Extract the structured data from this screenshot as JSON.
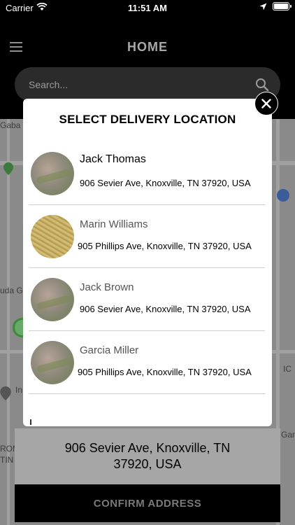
{
  "status_bar": {
    "carrier": "Carrier",
    "time": "11:51 AM"
  },
  "header": {
    "title": "HOME"
  },
  "search": {
    "placeholder": "Search..."
  },
  "map": {
    "labels": [
      "Gaba T",
      "uda Ga",
      "In",
      "Gard",
      "IC",
      "ROM",
      "TIN"
    ]
  },
  "modal": {
    "title": "SELECT DELIVERY LOCATION",
    "locations": [
      {
        "name": "Jack Thomas",
        "address": "906 Sevier Ave, Knoxville, TN 37920, USA"
      },
      {
        "name": "Marin Williams",
        "address": "905 Phillips Ave, Knoxville, TN 37920, USA"
      },
      {
        "name": "Jack Brown",
        "address": "906 Sevier Ave, Knoxville, TN 37920, USA"
      },
      {
        "name": "Garcia Miller",
        "address": "905 Phillips Ave, Knoxville, TN 37920, USA"
      }
    ]
  },
  "selected_address": "906 Sevier Ave, Knoxville, TN 37920, USA",
  "confirm_label": "CONFIRM ADDRESS",
  "colors": {
    "background": "#000000",
    "search_bg": "#2b2b2b",
    "address_panel_bg": "#a6a6a6",
    "confirm_text": "#7a7a7a"
  }
}
